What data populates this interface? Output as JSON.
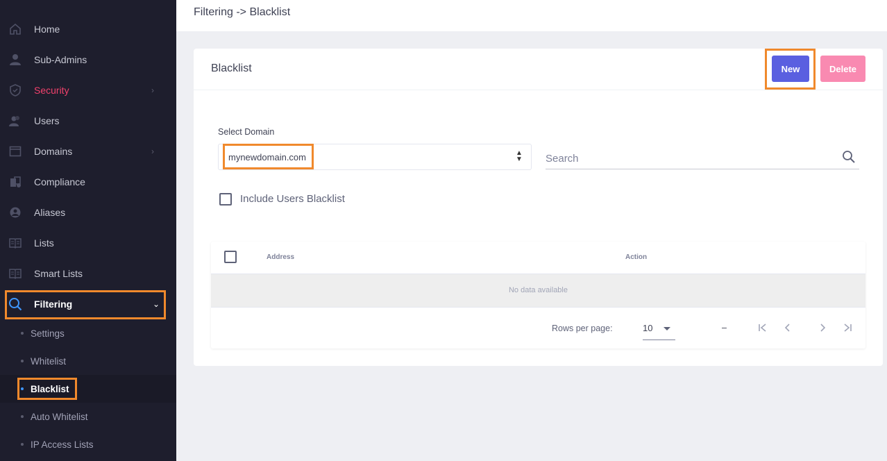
{
  "header": {
    "breadcrumb": "Filtering -> Blacklist"
  },
  "sidebar": {
    "items": [
      {
        "label": "Home",
        "icon": "home-icon"
      },
      {
        "label": "Sub-Admins",
        "icon": "person-icon"
      },
      {
        "label": "Security",
        "icon": "shield-icon",
        "has_children": true
      },
      {
        "label": "Users",
        "icon": "users-icon"
      },
      {
        "label": "Domains",
        "icon": "window-icon",
        "has_children": true
      },
      {
        "label": "Compliance",
        "icon": "compliance-icon"
      },
      {
        "label": "Aliases",
        "icon": "alias-icon"
      },
      {
        "label": "Lists",
        "icon": "book-icon"
      },
      {
        "label": "Smart Lists",
        "icon": "book-icon"
      },
      {
        "label": "Filtering",
        "icon": "search-icon",
        "expanded": true
      }
    ],
    "subitems": [
      {
        "label": "Settings"
      },
      {
        "label": "Whitelist"
      },
      {
        "label": "Blacklist",
        "current": true
      },
      {
        "label": "Auto Whitelist"
      },
      {
        "label": "IP Access Lists"
      }
    ]
  },
  "card": {
    "title": "Blacklist",
    "new_label": "New",
    "delete_label": "Delete",
    "select_domain_label": "Select Domain",
    "selected_domain": "mynewdomain.com",
    "search_placeholder": "Search",
    "include_users_label": "Include Users Blacklist",
    "include_users_checked": false
  },
  "table": {
    "columns": [
      "Address",
      "Action"
    ],
    "no_data": "No data available",
    "rows_per_page_label": "Rows per page:",
    "rows_per_page": "10",
    "range": "–"
  },
  "colors": {
    "sidebar_bg": "#1e1e2d",
    "accent": "#5a5fe0",
    "danger_light": "#f98ab1",
    "security_text": "#f1416c",
    "highlight": "#f0892c"
  }
}
